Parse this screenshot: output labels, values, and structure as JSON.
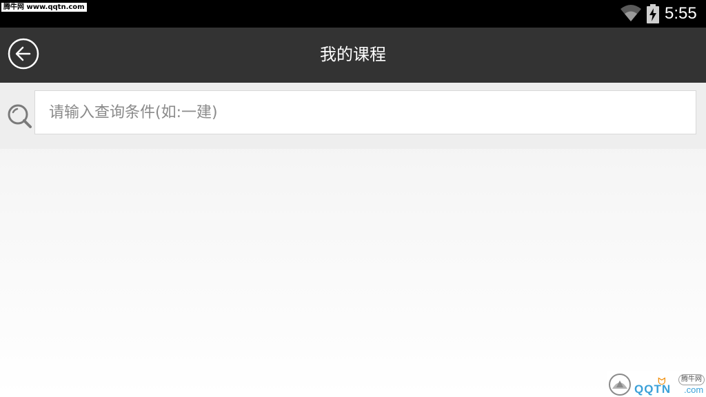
{
  "status_bar": {
    "watermark": "腾牛网 www.qqtn.com",
    "time": "5:55",
    "icons": [
      "wifi-icon",
      "battery-charging-icon"
    ]
  },
  "header": {
    "title": "我的课程",
    "back_icon": "back-arrow-icon"
  },
  "search": {
    "icon": "search-icon",
    "placeholder": "请输入查询条件(如:一建)",
    "value": ""
  },
  "watermark_logo": {
    "badge": "腾牛网",
    "text": "QQTN",
    "suffix": ".com"
  },
  "colors": {
    "status_bar": "#000000",
    "title_bar": "#333333",
    "background": "#eeeeee",
    "accent_watermark": "#3aa0d8"
  }
}
